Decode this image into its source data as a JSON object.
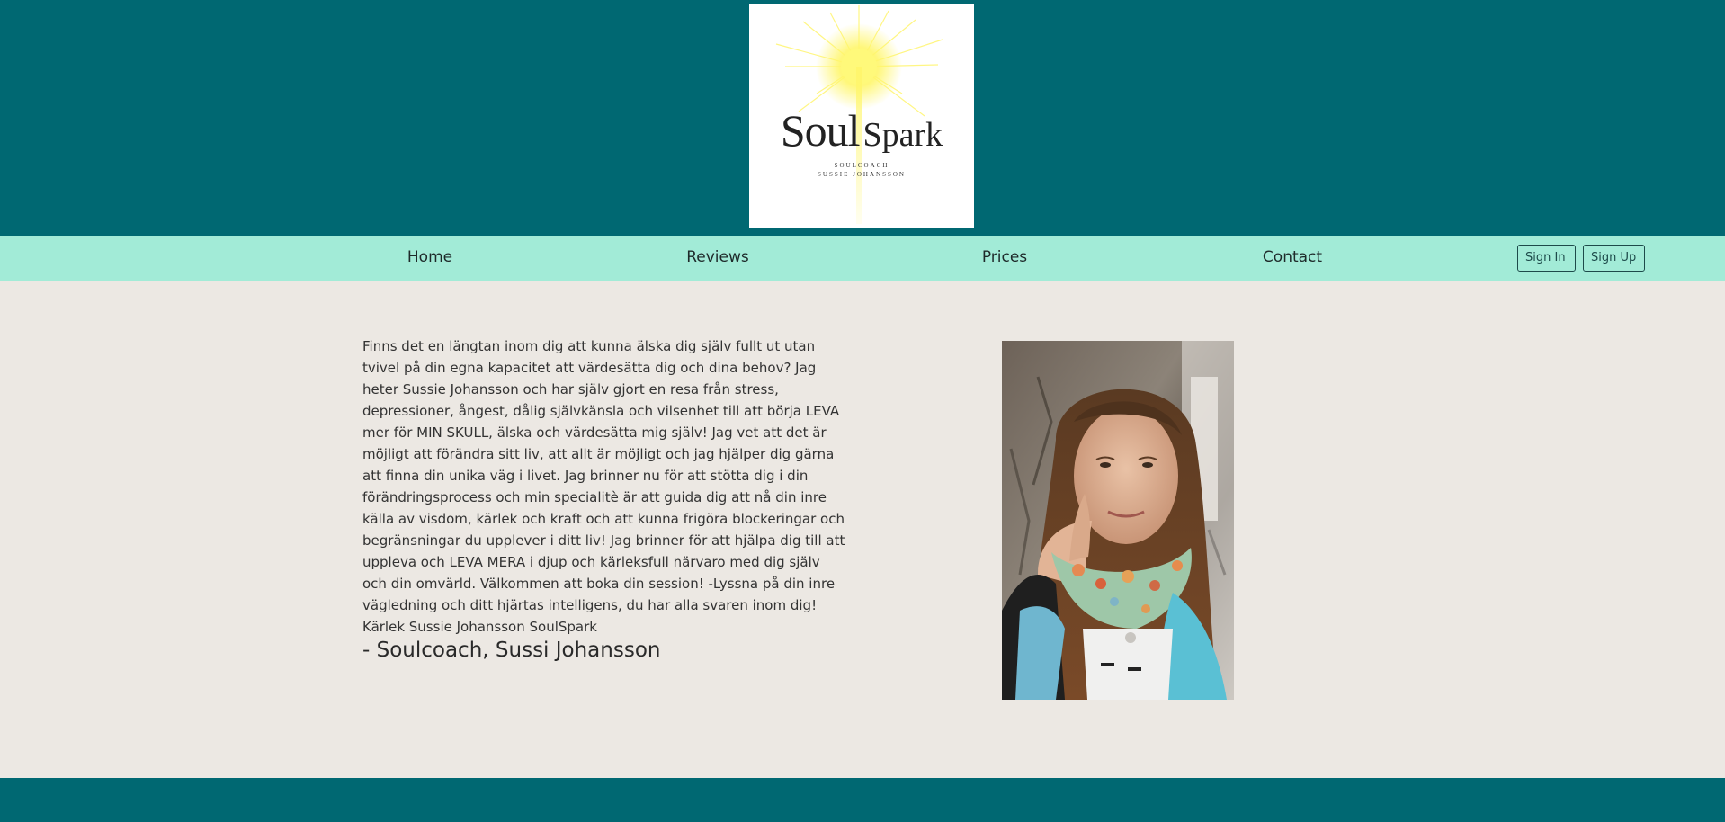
{
  "header": {
    "logo": {
      "word1": "Soul",
      "word2": "Spark",
      "line1": "SOULCOACH",
      "line2": "SUSSIE JOHANSSON"
    },
    "background_color": "#006872"
  },
  "nav": {
    "background_color": "#a2ebd7",
    "items": [
      {
        "label": "Home"
      },
      {
        "label": "Reviews"
      },
      {
        "label": "Prices"
      },
      {
        "label": "Contact"
      }
    ],
    "sign_in": "Sign In",
    "sign_up": "Sign Up"
  },
  "main": {
    "bio": "Finns det en längtan inom dig att kunna älska dig själv fullt ut utan tvivel på din egna kapacitet att värdesätta dig och dina behov? Jag heter Sussie Johansson och har själv gjort en resa från stress, depressioner, ångest, dålig självkänsla och vilsenhet till att börja LEVA mer för MIN SKULL, älska och värdesätta mig själv! Jag vet att det är möjligt att förändra sitt liv, att allt är möjligt och jag hjälper dig gärna att finna din unika väg i livet. Jag brinner nu för att stötta dig i din förändringsprocess och min specialitè är att guida dig att nå din inre källa av visdom, kärlek och kraft och att kunna frigöra blockeringar och begränsningar du upplever i ditt liv! Jag brinner för att hjälpa dig till att uppleva och LEVA MERA i djup och kärleksfull närvaro med dig själv och din omvärld. Välkommen att boka din session! -Lyssna på din inre vägledning och ditt hjärtas intelligens, du har alla svaren inom dig! Kärlek Sussie Johansson SoulSpark",
    "signature": "- Soulcoach, Sussi Johansson",
    "background_color": "#ece8e3"
  },
  "footer": {
    "background_color": "#006872"
  }
}
